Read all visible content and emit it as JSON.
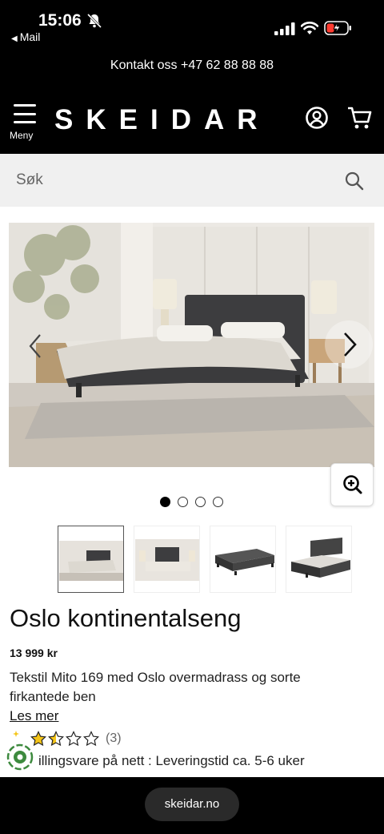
{
  "status_bar": {
    "time": "15:06",
    "back_label": "Mail"
  },
  "contact": {
    "text": "Kontakt oss +47 62 88 88 88"
  },
  "header": {
    "menu_label": "Meny",
    "logo_text": "SKEIDAR"
  },
  "search": {
    "placeholder": "Søk"
  },
  "gallery": {
    "dot_count": 4,
    "active_index": 0
  },
  "product": {
    "title": "Oslo kontinentalseng",
    "price": "13 999 kr",
    "description": "Tekstil Mito 169 med Oslo overmadrass og sorte firkantede ben",
    "read_more": "Les mer",
    "rating": 1.5,
    "rating_max": 5,
    "review_count": "(3)",
    "delivery": "illingsvare på nett : Leveringstid ca. 5-6 uker"
  },
  "browser": {
    "url": "skeidar.no"
  },
  "colors": {
    "header_bg": "#000000",
    "search_bg": "#f0f0f0",
    "star_fill": "#f5c518"
  },
  "icons": [
    "bell-slash-icon",
    "signal-icon",
    "wifi-icon",
    "battery-charging-icon",
    "hamburger-menu-icon",
    "account-icon",
    "cart-icon",
    "search-icon",
    "chevron-left-icon",
    "chevron-right-icon",
    "zoom-in-icon",
    "star-icon",
    "sustainability-badge-icon"
  ]
}
